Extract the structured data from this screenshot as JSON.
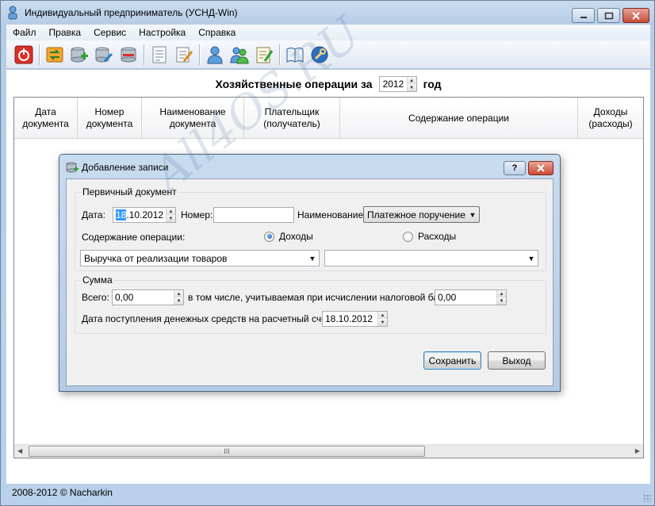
{
  "window": {
    "title": "Индивидуальный предприниматель (УСНД-Win)"
  },
  "menu": [
    "Файл",
    "Правка",
    "Сервис",
    "Настройка",
    "Справка"
  ],
  "toolbar": {
    "icons": [
      "power-icon",
      "exchange-icon",
      "database-add-icon",
      "database-edit-icon",
      "database-delete-icon",
      "notes-icon",
      "edit-doc-icon",
      "user-icon",
      "users-icon",
      "edit-icon",
      "book-icon",
      "settings-icon"
    ]
  },
  "main": {
    "heading_prefix": "Хозяйственные операции за",
    "year": "2012",
    "heading_suffix": "год",
    "columns": [
      "Дата документа",
      "Номер документа",
      "Наименование документа",
      "Плательщик (получатель)",
      "Содержание операции",
      "Доходы (расходы)"
    ],
    "scroll_thumb": "III"
  },
  "dialog": {
    "title": "Добавление записи",
    "help_label": "?",
    "group1": {
      "label": "Первичный документ",
      "date_label": "Дата:",
      "date_day": "18",
      "date_rest": ".10.2012",
      "number_label": "Номер:",
      "number_value": "",
      "name_label": "Наименование:",
      "name_value": "Платежное поручение",
      "operation_label": "Содержание операции:",
      "radio_income": "Доходы",
      "radio_expense": "Расходы",
      "operation_value": "Выручка от реализации товаров",
      "operation_value2": ""
    },
    "group2": {
      "label": "Сумма",
      "total_label": "Всего:",
      "total_value": "0,00",
      "taxbase_label": "в том числе, учитываемая при исчислении налоговой базы:",
      "taxbase_value": "0,00",
      "receipt_label": "Дата поступления денежных средств на расчетный счет:",
      "receipt_value": "18.10.2012"
    },
    "save_label": "Сохранить",
    "exit_label": "Выход"
  },
  "status": {
    "text": "2008-2012 ©  Nacharkin"
  },
  "watermark": "All4OS.RU"
}
